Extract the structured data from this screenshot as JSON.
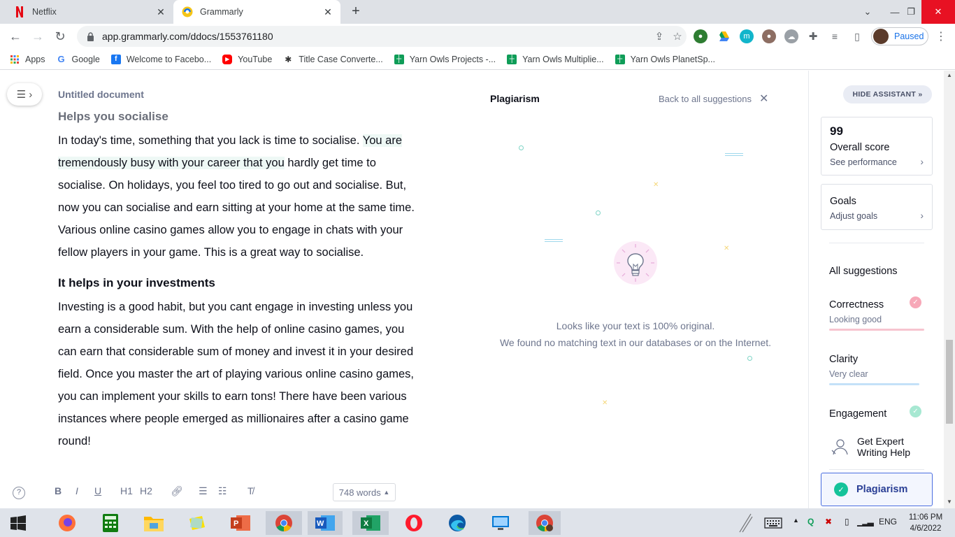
{
  "browser": {
    "tabs": [
      {
        "title": "Netflix",
        "icon": "netflix-icon",
        "active": false
      },
      {
        "title": "Grammarly",
        "icon": "grammarly-icon",
        "active": true
      }
    ],
    "url": "app.grammarly.com/ddocs/1553761180",
    "profile_label": "Paused",
    "bookmarks": [
      {
        "label": "Apps",
        "icon": "apps-grid-icon"
      },
      {
        "label": "Google",
        "icon": "google-icon"
      },
      {
        "label": "Welcome to Facebo...",
        "icon": "facebook-icon"
      },
      {
        "label": "YouTube",
        "icon": "youtube-icon"
      },
      {
        "label": "Title Case Converte...",
        "icon": "title-case-icon"
      },
      {
        "label": "Yarn Owls Projects -...",
        "icon": "sheets-icon"
      },
      {
        "label": "Yarn Owls Multiplie...",
        "icon": "sheets-icon"
      },
      {
        "label": "Yarn Owls PlanetSp...",
        "icon": "sheets-icon"
      }
    ]
  },
  "document": {
    "title": "Untitled document",
    "heading1": "Helps you socialise",
    "para1_before": "In today's time, something that you lack is time to socialise. ",
    "para1_highlight": "You are tremendously busy with your career that you",
    "para1_after": " hardly get time to socialise. On holidays, you feel too tired to go out and socialise. But, now you can socialise and earn sitting at your home at the same time. Various online casino games allow you to engage in chats with your fellow players in your game. This is a great way to socialise.",
    "heading2": "It helps in your investments",
    "para2": "Investing is a good habit, but you cant engage in investing unless you earn a considerable sum. With the help of online casino games, you can earn that considerable sum of money and invest it in your desired field. Once you master the art of playing various online casino games, you can implement your skills to earn tons! There have been various instances where people emerged as millionaires after a casino game round!",
    "word_count": "748 words",
    "format_buttons": [
      "B",
      "I",
      "U",
      "H1",
      "H2"
    ]
  },
  "plagiarism": {
    "title": "Plagiarism",
    "back_label": "Back to all suggestions",
    "message_line1": "Looks like your text is 100% original.",
    "message_line2": "We found no matching text in our databases or on the Internet."
  },
  "assistant": {
    "hide_label": "HIDE ASSISTANT",
    "score": "99",
    "score_label": "Overall score",
    "score_link": "See performance",
    "goals_label": "Goals",
    "goals_link": "Adjust goals",
    "all_suggestions": "All suggestions",
    "correctness": {
      "label": "Correctness",
      "status": "Looking good",
      "color": "#f7a8b8"
    },
    "clarity": {
      "label": "Clarity",
      "status": "Very clear",
      "color": "#a9d3f5"
    },
    "engagement": {
      "label": "Engagement",
      "color": "#a7e8d2"
    },
    "expert_label": "Get Expert Writing Help",
    "plagiarism_label": "Plagiarism"
  },
  "taskbar": {
    "lang": "ENG",
    "time": "11:06 PM",
    "date": "4/6/2022"
  }
}
